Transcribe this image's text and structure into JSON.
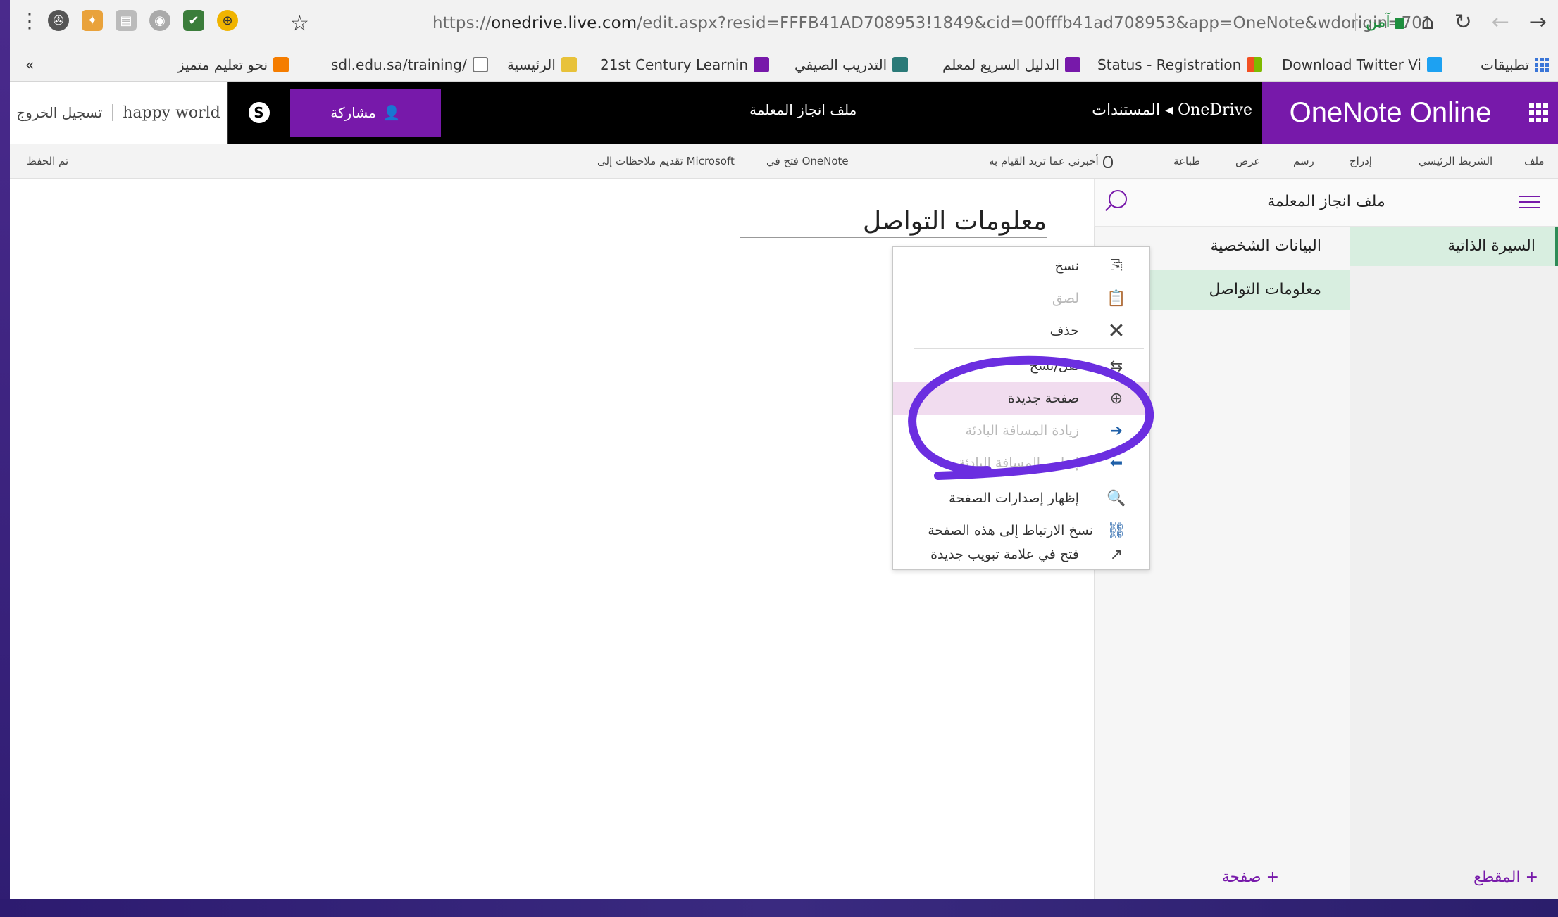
{
  "browser": {
    "url_prefix": "https://",
    "url_host": "onedrive.live.com",
    "url_rest": "/edit.aspx?resid=FFFB41AD708953!1849&cid=00fffb41ad708953&app=OneNote&wdorigin=701",
    "secure_label": "آمن"
  },
  "bookmarks": {
    "apps": "تطبيقات",
    "items": [
      "Download Twitter Vi",
      "Status - Registration",
      "الدليل السريع لمعلم",
      "التدريب الصيفي",
      "21st Century Learnin",
      "الرئيسية",
      "sdl.edu.sa/training/",
      "نحو تعليم متميز"
    ],
    "overflow": "«"
  },
  "suite": {
    "brand": "OneNote Online",
    "breadcrumb_root": "OneDrive",
    "breadcrumb_sep": "◂",
    "breadcrumb_folder": "المستندات",
    "document_title": "ملف انجاز المعلمة",
    "share_label": "مشاركة",
    "user_name": "happy world",
    "sign_out": "تسجيل الخروج"
  },
  "ribbon": {
    "tabs": [
      "ملف",
      "الشريط الرئيسي",
      "إدراج",
      "رسم",
      "عرض",
      "طباعة"
    ],
    "tell_me": "أخبرني عما تريد القيام به",
    "open_in_onenote": "فتح في OneNote",
    "submit_notes": "تقديم ملاحظات إلى Microsoft",
    "save_status": "تم الحفظ"
  },
  "notebook": {
    "name": "ملف انجاز المعلمة",
    "sections": [
      "السيرة الذاتية"
    ],
    "pages": [
      "البيانات الشخصية",
      "معلومات التواصل"
    ],
    "add_section": "المقطع",
    "add_page": "صفحة",
    "add_symbol": "+"
  },
  "page": {
    "title": "معلومات التواصل"
  },
  "context_menu": {
    "items": [
      {
        "label": "نسخ",
        "icon": "copy-icon",
        "disabled": false
      },
      {
        "label": "لصق",
        "icon": "paste-icon",
        "disabled": true
      },
      {
        "label": "حذف",
        "icon": "delete-icon",
        "disabled": false
      },
      {
        "label": "نقل/نسخ",
        "icon": "move-copy-icon",
        "disabled": false
      },
      {
        "label": "صفحة جديدة",
        "icon": "new-page-icon",
        "disabled": false,
        "highlighted": true
      },
      {
        "label": "زيادة المسافة البادئة",
        "icon": "indent-icon",
        "disabled": true
      },
      {
        "label": "إنقاص المسافة البادئة",
        "icon": "outdent-icon",
        "disabled": true
      },
      {
        "label": "إظهار إصدارات الصفحة",
        "icon": "page-versions-icon",
        "disabled": false
      },
      {
        "label": "نسخ الارتباط إلى هذه الصفحة",
        "icon": "copy-link-icon",
        "disabled": false
      },
      {
        "label": "فتح في علامة تبويب جديدة",
        "icon": "open-new-tab-icon",
        "disabled": false
      }
    ]
  },
  "colors": {
    "onenote_purple": "#7719aa",
    "selection_green": "#d8eee0",
    "annotation_purple": "#6b2ee0"
  }
}
